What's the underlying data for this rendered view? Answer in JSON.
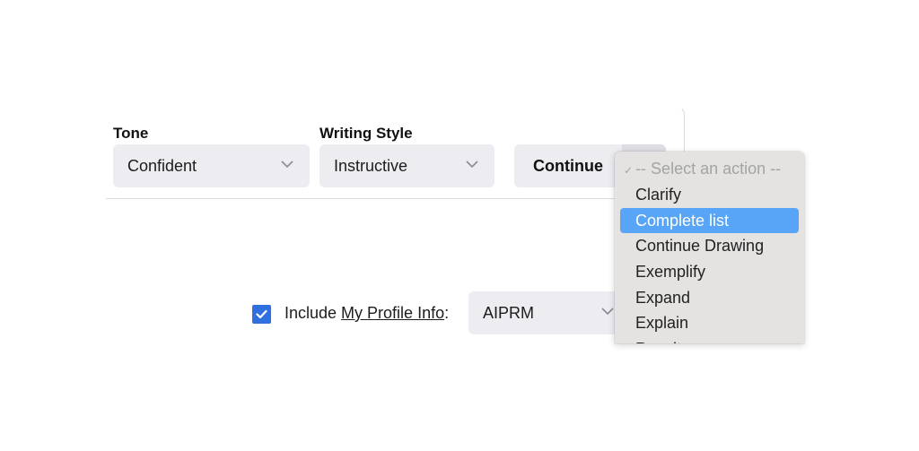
{
  "tone": {
    "label": "Tone",
    "value": "Confident"
  },
  "writing_style": {
    "label": "Writing Style",
    "value": "Instructive"
  },
  "continue_button": {
    "label": "Continue"
  },
  "action_menu": {
    "placeholder_check": "✓",
    "placeholder": "-- Select an action --",
    "items": [
      {
        "label": "Clarify"
      },
      {
        "label": "Complete list",
        "selected": true
      },
      {
        "label": "Continue Drawing"
      },
      {
        "label": "Exemplify"
      },
      {
        "label": "Expand"
      },
      {
        "label": "Explain"
      },
      {
        "label": "Rewrite"
      }
    ],
    "highlight_color": "#58a4f6"
  },
  "profile": {
    "checked": true,
    "include_text": "Include ",
    "link_text": "My Profile Info",
    "colon": ":",
    "value": "AIPRM"
  },
  "colors": {
    "checkbox": "#2f6fe0",
    "select_bg": "#ececf1"
  }
}
